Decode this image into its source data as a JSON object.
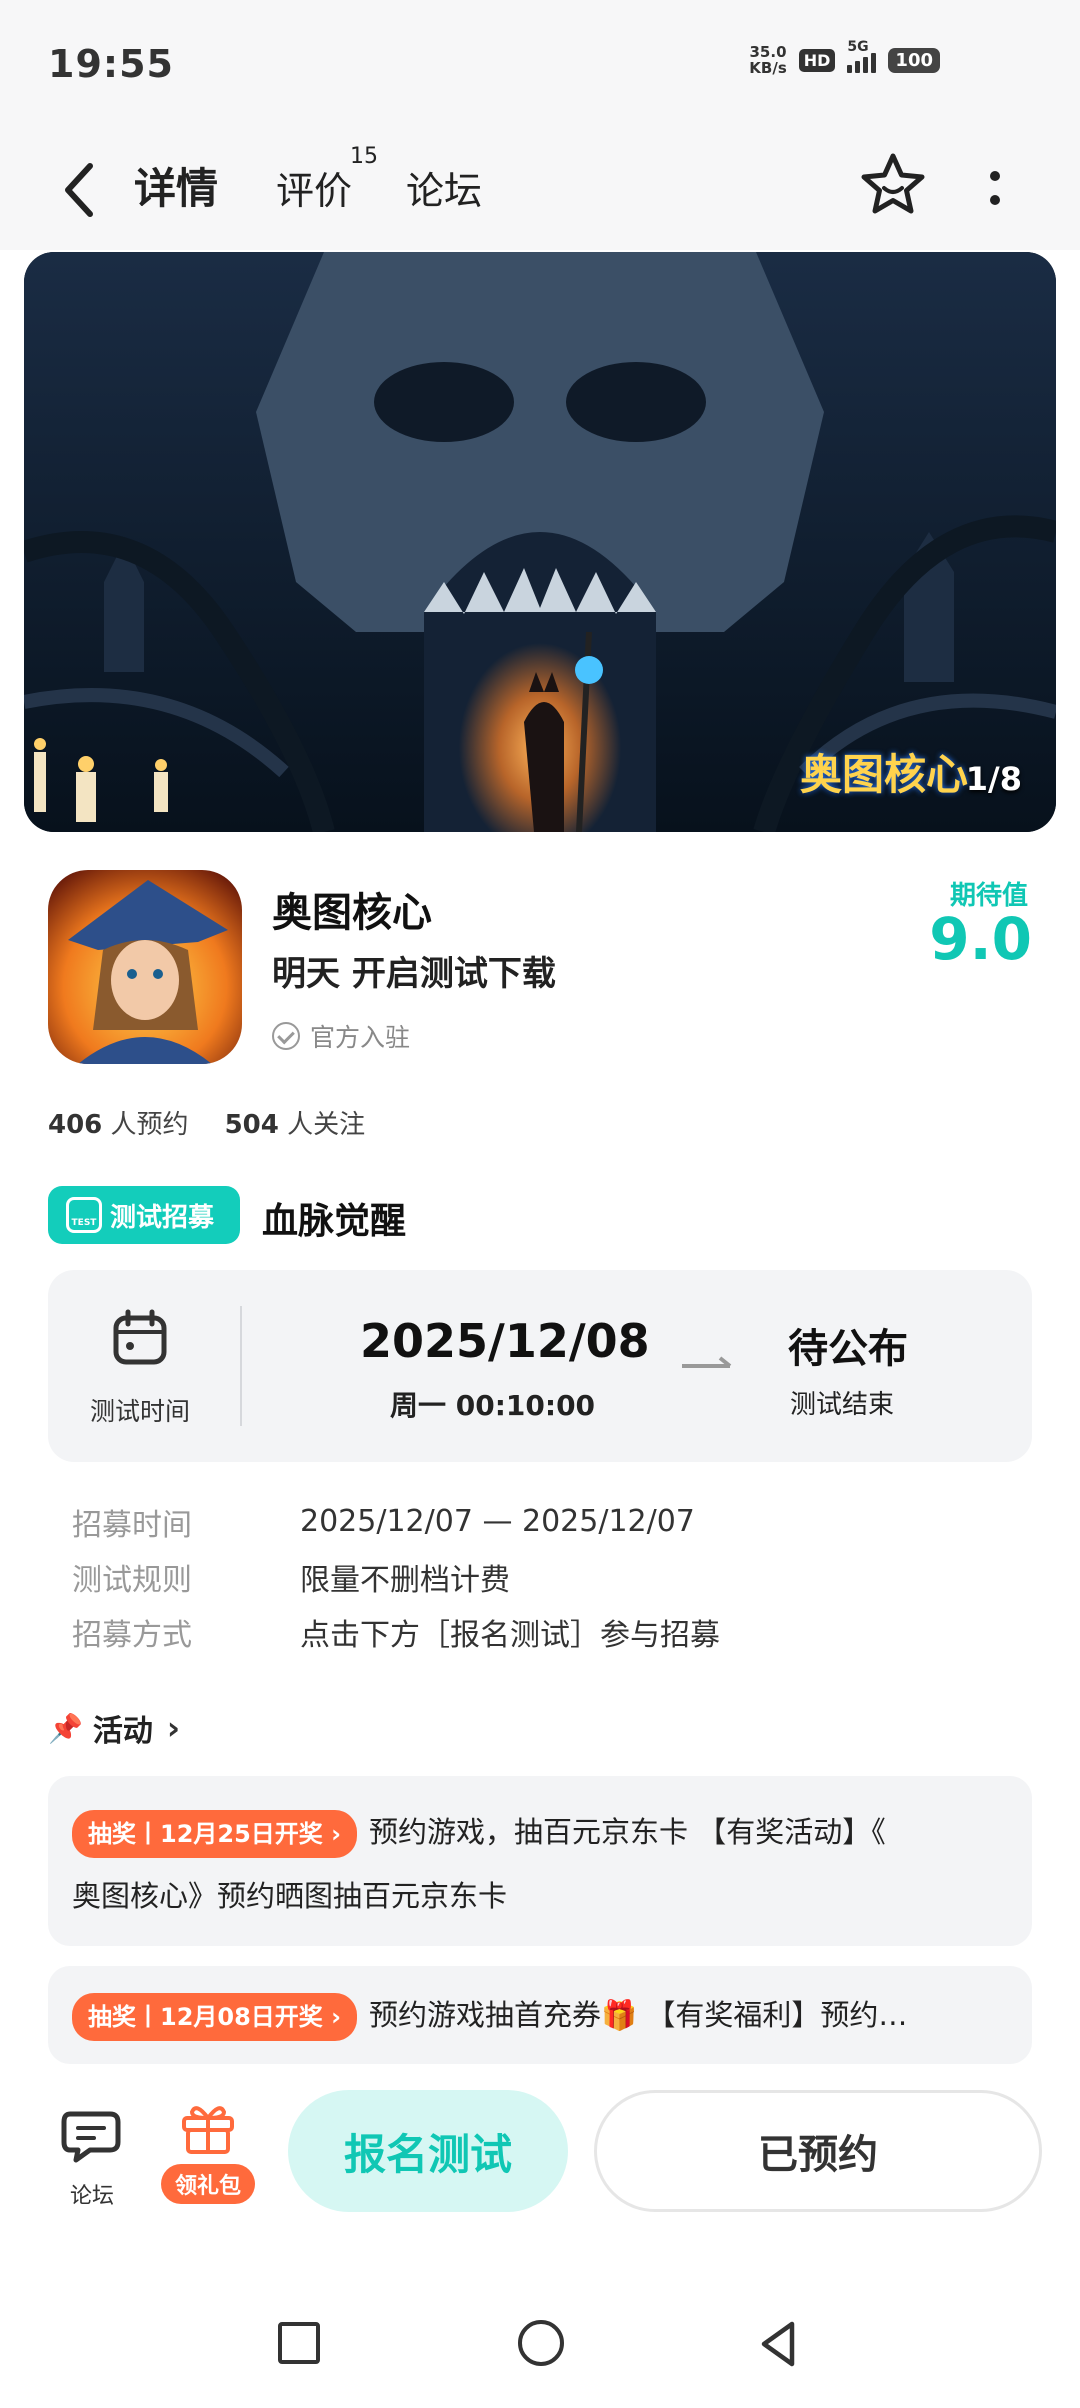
{
  "status_bar": {
    "time": "19:55",
    "net_speed_value": "35.0",
    "net_speed_unit": "KB/s",
    "hd_label": "HD",
    "network_label": "5G",
    "battery": "100"
  },
  "nav": {
    "tabs": [
      {
        "label": "详情",
        "active": true
      },
      {
        "label": "评价",
        "count": "15"
      },
      {
        "label": "论坛"
      }
    ],
    "icons": [
      "back-icon",
      "star-face-icon",
      "more-vertical-icon"
    ]
  },
  "banner": {
    "logo_text": "奥图核心",
    "counter": "1/8"
  },
  "game": {
    "name": "奥图核心",
    "release": "明天 开启测试下载",
    "official_label": "官方入驻",
    "expect_label": "期待值",
    "expect_score": "9.0",
    "reservations": "406",
    "reservations_label": "人预约",
    "followers": "504",
    "followers_label": "人关注"
  },
  "test": {
    "badge_label": "测试招募",
    "badge_icon_text": "TEST",
    "name": "血脉觉醒",
    "time_label": "测试时间",
    "start_date": "2025/12/08",
    "start_time": "周一  00:10:00",
    "end_status": "待公布",
    "end_label": "测试结束",
    "info": [
      {
        "key": "招募时间",
        "value": "2025/12/07 — 2025/12/07"
      },
      {
        "key": "测试规则",
        "value": "限量不删档计费"
      },
      {
        "key": "招募方式",
        "value": "点击下方［报名测试］参与招募"
      }
    ]
  },
  "activities": {
    "title": "活动",
    "items": [
      {
        "tag": "抽奖丨12月25日开奖 ›",
        "text_line1": "预约游戏，抽百元京东卡 【有奖活动】《",
        "text_line2": "奥图核心》预约晒图抽百元京东卡"
      },
      {
        "tag": "抽奖丨12月08日开奖 ›",
        "text_line1": "预约游戏抽首充券🎁 【有奖福利】预约…"
      }
    ]
  },
  "bottom_bar": {
    "forum_label": "论坛",
    "gift_label": "领礼包",
    "signup_label": "报名测试",
    "reserved_label": "已预约"
  },
  "colors": {
    "accent": "#13CDBB",
    "orange": "#FF6A3C",
    "card_bg": "#F3F4F6"
  }
}
